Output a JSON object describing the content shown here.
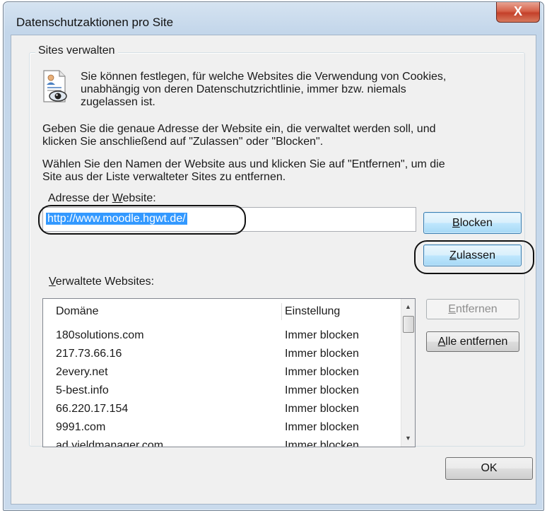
{
  "window": {
    "title": "Datenschutzaktionen pro Site",
    "close_label": "X"
  },
  "group": {
    "label": "Sites verwalten",
    "icon": "document-eye-icon",
    "intro_line1": "Sie können festlegen, für welche Websites die Verwendung von Cookies,",
    "intro_line2": "unabhängig von deren Datenschutzrichtlinie, immer bzw. niemals",
    "intro_line3": "zugelassen ist.",
    "instr1_line1": "Geben Sie die genaue Adresse der Website ein, die verwaltet werden soll, und",
    "instr1_line2": "klicken Sie anschließend auf \"Zulassen\" oder \"Blocken\".",
    "instr2_line1": "Wählen Sie den Namen der Website aus und klicken Sie auf \"Entfernen\", um die",
    "instr2_line2": "Site aus der Liste verwalteter Sites zu entfernen."
  },
  "address": {
    "label_before": "Adresse der ",
    "label_access_key": "W",
    "label_after": "ebsite:",
    "value": "http://www.moodle.hgwt.de/"
  },
  "buttons": {
    "block_key": "B",
    "block_rest": "locken",
    "allow_key": "Z",
    "allow_rest": "ulassen",
    "remove_key": "E",
    "remove_rest": "ntfernen",
    "remove_all_key": "A",
    "remove_all_rest": "lle entfernen",
    "ok": "OK"
  },
  "managed": {
    "label_key": "V",
    "label_rest": "erwaltete Websites:",
    "columns": [
      "Domäne",
      "Einstellung"
    ],
    "rows": [
      {
        "domain": "180solutions.com",
        "setting": "Immer blocken"
      },
      {
        "domain": "217.73.66.16",
        "setting": "Immer blocken"
      },
      {
        "domain": "2every.net",
        "setting": "Immer blocken"
      },
      {
        "domain": "5-best.info",
        "setting": "Immer blocken"
      },
      {
        "domain": "66.220.17.154",
        "setting": "Immer blocken"
      },
      {
        "domain": "9991.com",
        "setting": "Immer blocken"
      },
      {
        "domain": "ad.yieldmanager.com",
        "setting": "Immer blocken"
      }
    ],
    "scroll_up_icon": "▲",
    "scroll_down_icon": "▼"
  }
}
